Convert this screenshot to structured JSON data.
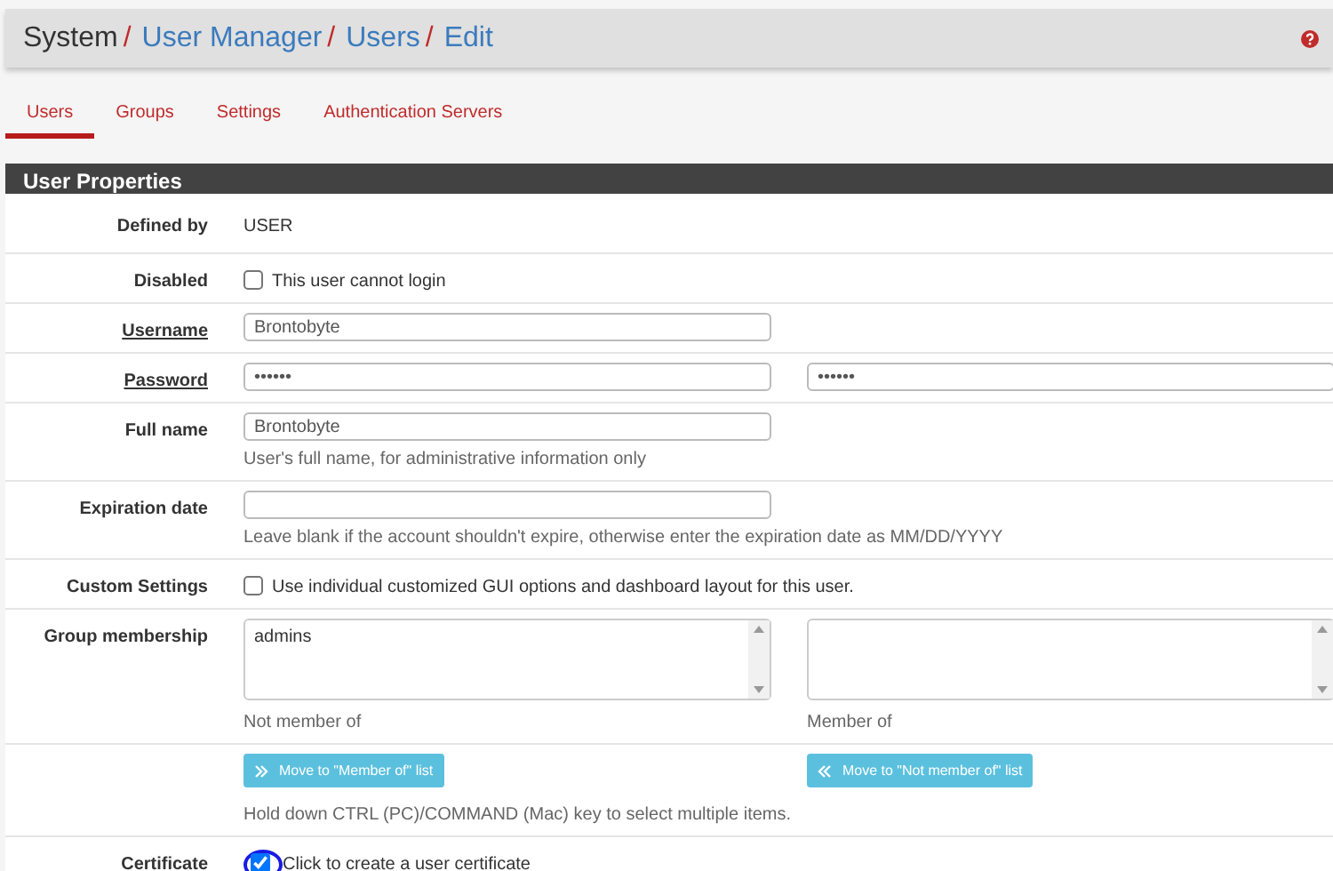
{
  "breadcrumb": [
    {
      "label": "System",
      "link": false
    },
    {
      "separator": "/",
      "label": "User Manager",
      "link": true
    },
    {
      "separator": "/",
      "label": "Users",
      "link": true
    },
    {
      "separator": "/",
      "label": "Edit",
      "link": true
    }
  ],
  "tabs": [
    {
      "label": "Users",
      "selected": true
    },
    {
      "label": "Groups",
      "selected": false
    },
    {
      "label": "Settings",
      "selected": false
    },
    {
      "label": "Authentication Servers",
      "selected": false
    }
  ],
  "panel": {
    "title": "User Properties",
    "rows": [
      {
        "label": "Defined by",
        "kind": "static",
        "value": "USER"
      },
      {
        "label": "Disabled",
        "kind": "checkbox",
        "checked": false,
        "text": "This user cannot login"
      },
      {
        "label": "Username",
        "required": true,
        "kind": "inputs",
        "fields": [
          {
            "value": "Brontobyte"
          }
        ]
      },
      {
        "label": "Password",
        "required": true,
        "kind": "inputs",
        "fields": [
          {
            "value": "••••••"
          },
          {
            "value": "••••••"
          }
        ]
      },
      {
        "label": "Full name",
        "kind": "inputs",
        "fields": [
          {
            "value": "Brontobyte"
          }
        ],
        "help": "User's full name, for administrative information only"
      },
      {
        "label": "Expiration date",
        "kind": "empty_input",
        "help": "Leave blank if the account shouldn't expire, otherwise enter the expiration date as MM/DD/YYYY"
      },
      {
        "label": "Custom Settings",
        "kind": "checkbox",
        "checked": false,
        "text": "Use individual customized GUI options and dashboard layout for this user."
      },
      {
        "label": "Group membership",
        "kind": "selects",
        "lists": [
          {
            "options": [
              "admins"
            ],
            "caption": "Not member of"
          },
          {
            "caption": "Member of"
          }
        ]
      },
      {
        "kind": "buttons",
        "buttons": [
          {
            "label": "Move to \"Member of\" list",
            "kind": "add"
          },
          {
            "label": "Move to \"Not member of\" list",
            "kind": "remove"
          }
        ],
        "help": "Hold down CTRL (PC)/COMMAND (Mac) key to select multiple items."
      },
      {
        "label": "Certificate",
        "kind": "checkbox",
        "checked": true,
        "highlighted": true,
        "text": "Click to create a user certificate"
      }
    ]
  }
}
